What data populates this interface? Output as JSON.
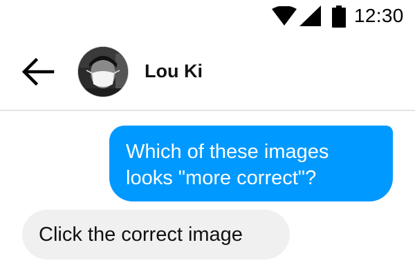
{
  "status_bar": {
    "time": "12:30",
    "icons": [
      "wifi-icon",
      "signal-icon",
      "battery-icon"
    ]
  },
  "header": {
    "back_icon": "arrow-left-icon",
    "avatar": "avatar",
    "contact_name": "Lou Ki"
  },
  "messages": [
    {
      "direction": "sent",
      "text": "Which of these images looks \"more correct\"?",
      "bubble_color": "#0099ff"
    },
    {
      "direction": "received",
      "text": "Click the correct image",
      "bubble_color": "#f0f0f0"
    }
  ]
}
